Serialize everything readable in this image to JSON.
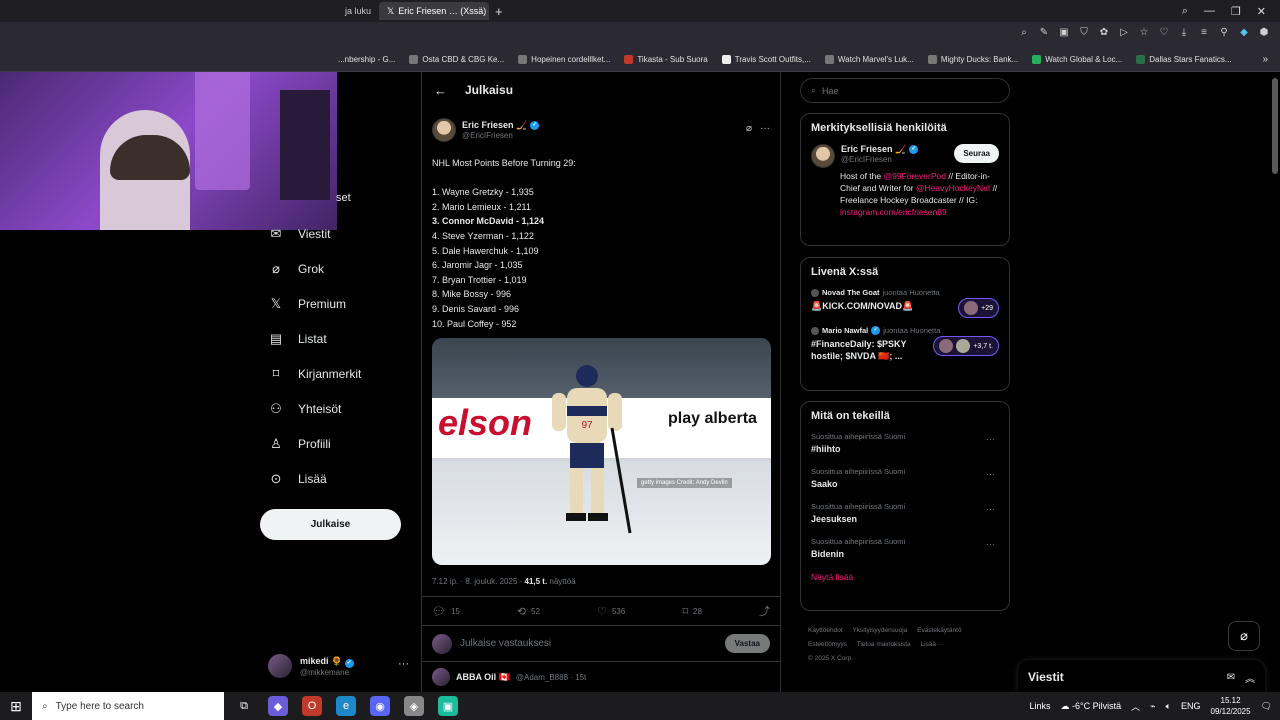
{
  "browser": {
    "tabs": [
      {
        "label": "ja luku",
        "active": false
      },
      {
        "label": "Eric Friesen … (Xssä) \"NH…",
        "active": true
      }
    ],
    "bookmarks": [
      "...nbership - G...",
      "Osta CBD & CBG Ke...",
      "Hopeinen cordelllket...",
      "Tikasta - Sub Suora",
      "Travis Scott Outfits,...",
      "Watch Marvel's Luk...",
      "Mighty Ducks: Bank...",
      "Watch Global & Loc...",
      "Dallas Stars Fanatics..."
    ]
  },
  "nav": {
    "partial_label": "set",
    "items": [
      {
        "icon": "mail-icon",
        "label": "Viestit"
      },
      {
        "icon": "grok-icon",
        "label": "Grok"
      },
      {
        "icon": "x-logo-icon",
        "label": "Premium"
      },
      {
        "icon": "list-icon",
        "label": "Listat"
      },
      {
        "icon": "bookmark-icon",
        "label": "Kirjanmerkit"
      },
      {
        "icon": "communities-icon",
        "label": "Yhteisöt"
      },
      {
        "icon": "profile-icon",
        "label": "Profiili"
      },
      {
        "icon": "more-circle-icon",
        "label": "Lisää"
      }
    ],
    "post_button": "Julkaise",
    "account": {
      "name": "mikedi 🌻",
      "handle": "@mikkemane"
    }
  },
  "main": {
    "header": "Julkaisu",
    "post": {
      "author_name": "Eric Friesen 🏒",
      "author_handle": "@EricIFriesen",
      "lines": [
        "NHL Most Points Before Turning 29:",
        "",
        "1. Wayne Gretzky - 1,935",
        "2. Mario Lemieux - 1,211",
        "3. Connor McDavid - 1,124",
        "4. Steve Yzerman - 1,122",
        "5. Dale Hawerchuk - 1,109",
        "6. Jaromir Jagr - 1,035",
        "7. Bryan Trottier - 1,019",
        "8. Mike Bossy - 996",
        "9. Denis Savard - 996",
        "10. Paul Coffey - 952"
      ],
      "bold_line_index": 4,
      "image": {
        "brand_left": "elson",
        "brand_right": "play alberta",
        "credit": "getty images  Credit: Andy Devlin",
        "jersey": "97"
      },
      "meta_time": "7.12 ip. · 8. jouluk. 2025 · ",
      "meta_views": "41,5 t.",
      "meta_views_label": " näyttöä",
      "stats": {
        "replies": "15",
        "reposts": "52",
        "likes": "536",
        "bookmarks": "28"
      }
    },
    "reply_placeholder": "Julkaise vastauksesi",
    "reply_button": "Vastaa",
    "next_post": {
      "name": "ABBA Oil 🇨🇦",
      "handle": "@Adam_B888 · 15t"
    }
  },
  "sidebar": {
    "search_placeholder": "Hae",
    "relevant": {
      "title": "Merkityksellisiä henkilöitä",
      "name": "Eric Friesen 🏒",
      "handle": "@EricIFriesen",
      "follow": "Seuraa",
      "bio_1": "Host of the ",
      "bio_link_1": "@99ForeverPod",
      "bio_2": " // Editor-in-Chief and Writer for ",
      "bio_link_2": "@HeavyHockeyNet",
      "bio_3": " // Freelance Hockey Broadcaster // IG: ",
      "bio_link_3": "instagram.com/ericfriesen89"
    },
    "live": {
      "title": "Livenä X:ssä",
      "items": [
        {
          "host": "Novad The Goat",
          "context": "juontaa Huonetta",
          "title": "🚨KICK.COM/NOVAD🚨",
          "count": "+29"
        },
        {
          "host": "Mario Nawfal",
          "context": "juontaa Huonetta",
          "title": "#FinanceDaily: $PSKY hostile; $NVDA 🇨🇳; ...",
          "count": "+3,7 t."
        }
      ]
    },
    "trends": {
      "title": "Mitä on tekeillä",
      "items": [
        {
          "context": "Suosittua aihepiirissä Suomi",
          "topic": "#hiihto"
        },
        {
          "context": "Suosittua aihepiirissä Suomi",
          "topic": "Saako"
        },
        {
          "context": "Suosittua aihepiirissä Suomi",
          "topic": "Jeesuksen"
        },
        {
          "context": "Suosittua aihepiirissä Suomi",
          "topic": "Bidenin"
        }
      ],
      "show_more": "Näytä lisää"
    },
    "footer": [
      "Käyttöehdot",
      "Yksityisyydensuoja",
      "Evästekäytäntö",
      "Esteettömyys",
      "Tietoa mainoksista",
      "Lisää ···",
      "© 2025 X Corp."
    ]
  },
  "messages_bar": "Viestit",
  "taskbar": {
    "search_placeholder": "Type here to search",
    "links": "Links",
    "weather": "-6°C  Pilvistä",
    "lang": "ENG",
    "time": "15.12",
    "date": "09/12/2025"
  }
}
